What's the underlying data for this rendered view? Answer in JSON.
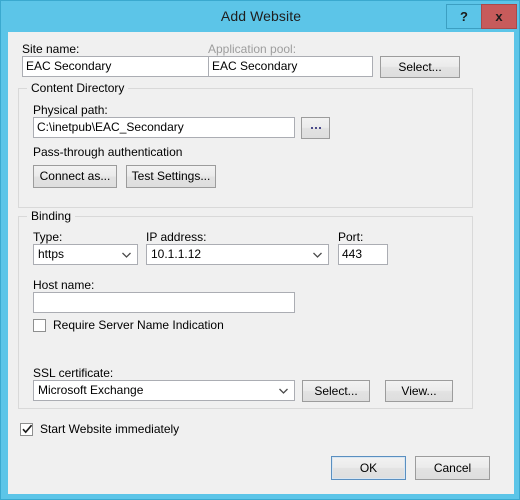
{
  "window": {
    "title": "Add Website",
    "help_button": "?",
    "close_button": "x",
    "titlebar_color": "#5CC5E8",
    "close_button_color": "#C75B5B"
  },
  "site": {
    "site_name_label": "Site name:",
    "site_name_value": "EAC Secondary",
    "app_pool_label": "Application pool:",
    "app_pool_value": "EAC Secondary",
    "app_pool_select_button": "Select..."
  },
  "content_directory": {
    "group_title": "Content Directory",
    "physical_path_label": "Physical path:",
    "physical_path_value": "C:\\inetpub\\EAC_Secondary",
    "browse_button": "...",
    "passthrough_text": "Pass-through authentication",
    "connect_as_button": "Connect as...",
    "test_settings_button": "Test Settings..."
  },
  "binding": {
    "group_title": "Binding",
    "type_label": "Type:",
    "type_value": "https",
    "ip_label": "IP address:",
    "ip_value": "10.1.1.12",
    "port_label": "Port:",
    "port_value": "443",
    "host_name_label": "Host name:",
    "host_name_value": "",
    "sni_label": "Require Server Name Indication",
    "sni_checked": false,
    "ssl_label": "SSL certificate:",
    "ssl_value": "Microsoft Exchange",
    "ssl_select_button": "Select...",
    "ssl_view_button": "View..."
  },
  "footer": {
    "start_website_label": "Start Website immediately",
    "start_website_checked": true,
    "ok_button": "OK",
    "cancel_button": "Cancel"
  }
}
